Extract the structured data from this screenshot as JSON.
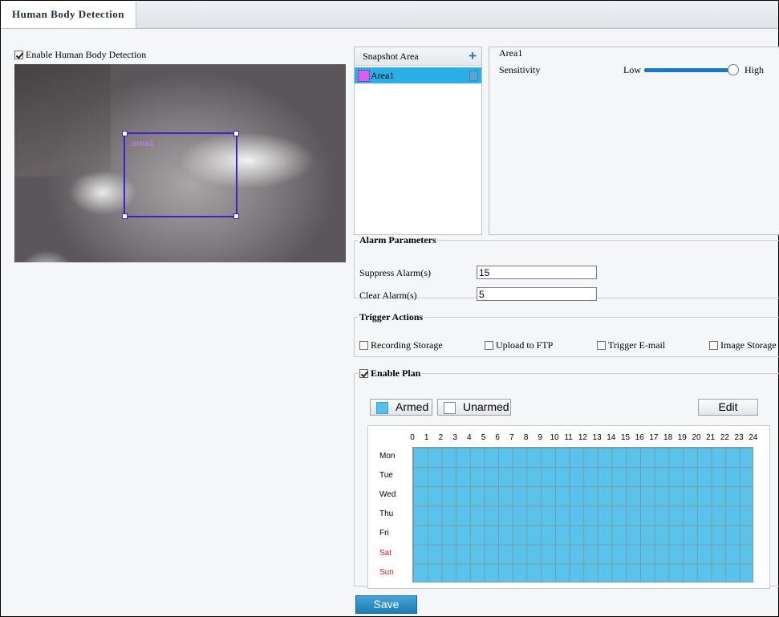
{
  "tab": {
    "title": "Human Body Detection"
  },
  "enable_detection": {
    "label": "Enable Human Body Detection",
    "checked": true
  },
  "video": {
    "roi_label": "area1"
  },
  "snapshot": {
    "header": "Snapshot Area",
    "add_icon": "plus-icon",
    "areas": [
      {
        "label": "Area1",
        "color": "#d65ef0",
        "selected": true
      }
    ]
  },
  "area_settings": {
    "title": "Area1",
    "sensitivity_label": "Sensitivity",
    "low_label": "Low",
    "high_label": "High",
    "sensitivity_level": 1.0
  },
  "alarm": {
    "legend": "Alarm Parameters",
    "suppress_label": "Suppress Alarm(s)",
    "suppress_value": "15",
    "clear_label": "Clear Alarm(s)",
    "clear_value": "5"
  },
  "trigger": {
    "legend": "Trigger Actions",
    "options": [
      {
        "label": "Recording Storage",
        "checked": false
      },
      {
        "label": "Upload to FTP",
        "checked": false
      },
      {
        "label": "Trigger E-mail",
        "checked": false
      },
      {
        "label": "Image Storage",
        "checked": false
      }
    ]
  },
  "plan": {
    "legend": "Enable Plan",
    "checked": true,
    "armed_label": "Armed",
    "unarmed_label": "Unarmed",
    "edit_label": "Edit",
    "hours": [
      "0",
      "1",
      "2",
      "3",
      "4",
      "5",
      "6",
      "7",
      "8",
      "9",
      "10",
      "11",
      "12",
      "13",
      "14",
      "15",
      "16",
      "17",
      "18",
      "19",
      "20",
      "21",
      "22",
      "23",
      "24"
    ],
    "days": [
      "Mon",
      "Tue",
      "Wed",
      "Thu",
      "Fri",
      "Sat",
      "Sun"
    ],
    "armed_color": "#5ac3ea",
    "weekend_color": "#e02020"
  },
  "save_label": "Save"
}
